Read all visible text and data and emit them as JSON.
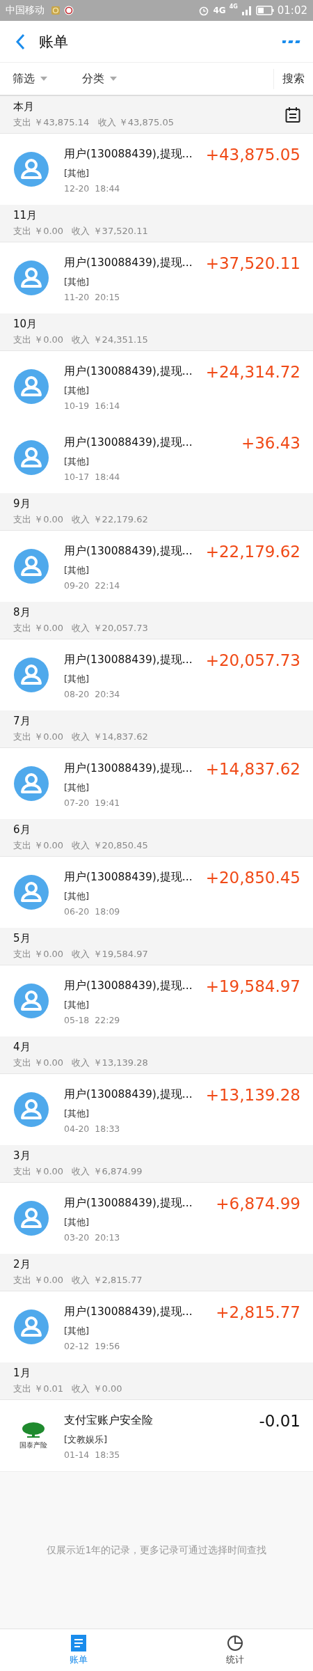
{
  "status_bar": {
    "carrier": "中国移动",
    "network": "4G",
    "signal_label": "4G",
    "time": "01:02"
  },
  "header": {
    "title": "账单"
  },
  "filters": [
    {
      "label": "筛选",
      "kind": "dropdown"
    },
    {
      "label": "分类",
      "kind": "dropdown"
    },
    {
      "label": "搜索",
      "kind": "plain"
    }
  ],
  "sections": [
    {
      "month": "本月",
      "summary": "支出 ￥43,875.14   收入 ￥43,875.05",
      "calendar": true,
      "rows": [
        {
          "kind": "avatar",
          "title": "用户(130088439),提现...",
          "category": "[其他]",
          "time": "12-20  18:44",
          "amount": "+43,875.05",
          "color": "#f04a17"
        }
      ]
    },
    {
      "month": "11月",
      "summary": "支出 ￥0.00   收入 ￥37,520.11",
      "calendar": false,
      "rows": [
        {
          "kind": "avatar",
          "title": "用户(130088439),提现...",
          "category": "[其他]",
          "time": "11-20  20:15",
          "amount": "+37,520.11",
          "color": "#f04a17"
        }
      ]
    },
    {
      "month": "10月",
      "summary": "支出 ￥0.00   收入 ￥24,351.15",
      "calendar": false,
      "rows": [
        {
          "kind": "avatar",
          "title": "用户(130088439),提现...",
          "category": "[其他]",
          "time": "10-19  16:14",
          "amount": "+24,314.72",
          "color": "#f04a17"
        },
        {
          "kind": "avatar",
          "title": "用户(130088439),提现...",
          "category": "[其他]",
          "time": "10-17  18:44",
          "amount": "+36.43",
          "color": "#f04a17"
        }
      ]
    },
    {
      "month": "9月",
      "summary": "支出 ￥0.00   收入 ￥22,179.62",
      "calendar": false,
      "rows": [
        {
          "kind": "avatar",
          "title": "用户(130088439),提现...",
          "category": "[其他]",
          "time": "09-20  22:14",
          "amount": "+22,179.62",
          "color": "#f04a17"
        }
      ]
    },
    {
      "month": "8月",
      "summary": "支出 ￥0.00   收入 ￥20,057.73",
      "calendar": false,
      "rows": [
        {
          "kind": "avatar",
          "title": "用户(130088439),提现...",
          "category": "[其他]",
          "time": "08-20  20:34",
          "amount": "+20,057.73",
          "color": "#f04a17"
        }
      ]
    },
    {
      "month": "7月",
      "summary": "支出 ￥0.00   收入 ￥14,837.62",
      "calendar": false,
      "rows": [
        {
          "kind": "avatar",
          "title": "用户(130088439),提现...",
          "category": "[其他]",
          "time": "07-20  19:41",
          "amount": "+14,837.62",
          "color": "#f04a17"
        }
      ]
    },
    {
      "month": "6月",
      "summary": "支出 ￥0.00   收入 ￥20,850.45",
      "calendar": false,
      "rows": [
        {
          "kind": "avatar",
          "title": "用户(130088439),提现...",
          "category": "[其他]",
          "time": "06-20  18:09",
          "amount": "+20,850.45",
          "color": "#f04a17"
        }
      ]
    },
    {
      "month": "5月",
      "summary": "支出 ￥0.00   收入 ￥19,584.97",
      "calendar": false,
      "rows": [
        {
          "kind": "avatar",
          "title": "用户(130088439),提现...",
          "category": "[其他]",
          "time": "05-18  22:29",
          "amount": "+19,584.97",
          "color": "#f04a17"
        }
      ]
    },
    {
      "month": "4月",
      "summary": "支出 ￥0.00   收入 ￥13,139.28",
      "calendar": false,
      "rows": [
        {
          "kind": "avatar",
          "title": "用户(130088439),提现...",
          "category": "[其他]",
          "time": "04-20  18:33",
          "amount": "+13,139.28",
          "color": "#f04a17"
        }
      ]
    },
    {
      "month": "3月",
      "summary": "支出 ￥0.00   收入 ￥6,874.99",
      "calendar": false,
      "rows": [
        {
          "kind": "avatar",
          "title": "用户(130088439),提现...",
          "category": "[其他]",
          "time": "03-20  20:13",
          "amount": "+6,874.99",
          "color": "#f04a17"
        }
      ]
    },
    {
      "month": "2月",
      "summary": "支出 ￥0.00   收入 ￥2,815.77",
      "calendar": false,
      "rows": [
        {
          "kind": "avatar",
          "title": "用户(130088439),提现...",
          "category": "[其他]",
          "time": "02-12  19:56",
          "amount": "+2,815.77",
          "color": "#f04a17"
        }
      ]
    },
    {
      "month": "1月",
      "summary": "支出 ￥0.01   收入 ￥0.00",
      "calendar": false,
      "rows": [
        {
          "kind": "logo",
          "logo_text": "国泰产险",
          "title": "支付宝账户安全险",
          "category": "[文教娱乐]",
          "time": "01-14  18:35",
          "amount": "-0.01",
          "color": "#111111"
        }
      ]
    }
  ],
  "footer_note": "仅展示近1年的记录，更多记录可通过选择时间查找",
  "tabs": [
    {
      "label": "账单",
      "kind": "list",
      "selected": true
    },
    {
      "label": "统计",
      "kind": "chart",
      "selected": false
    }
  ]
}
